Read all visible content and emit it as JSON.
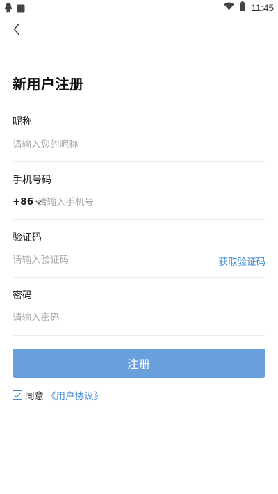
{
  "status_bar": {
    "time": "11:45",
    "icons": [
      "qq-icon",
      "notification-icon",
      "wifi-icon",
      "battery-icon"
    ]
  },
  "page": {
    "title": "新用户注册"
  },
  "form": {
    "nickname": {
      "label": "昵称",
      "placeholder": "请输入您的昵称",
      "value": ""
    },
    "phone": {
      "label": "手机号码",
      "country_code": "+86",
      "placeholder": "请输入手机号",
      "value": ""
    },
    "code": {
      "label": "验证码",
      "placeholder": "请输入验证码",
      "value": "",
      "get_code": "获取验证码"
    },
    "password": {
      "label": "密码",
      "placeholder": "请输入密码",
      "value": ""
    }
  },
  "actions": {
    "register": "注册"
  },
  "agreement": {
    "checked": true,
    "prefix": "同意",
    "link": "《用户协议》"
  },
  "colors": {
    "accent": "#3b86d6",
    "button": "#6a9fdd",
    "placeholder": "#a7a7a7",
    "divider": "#ececec"
  }
}
